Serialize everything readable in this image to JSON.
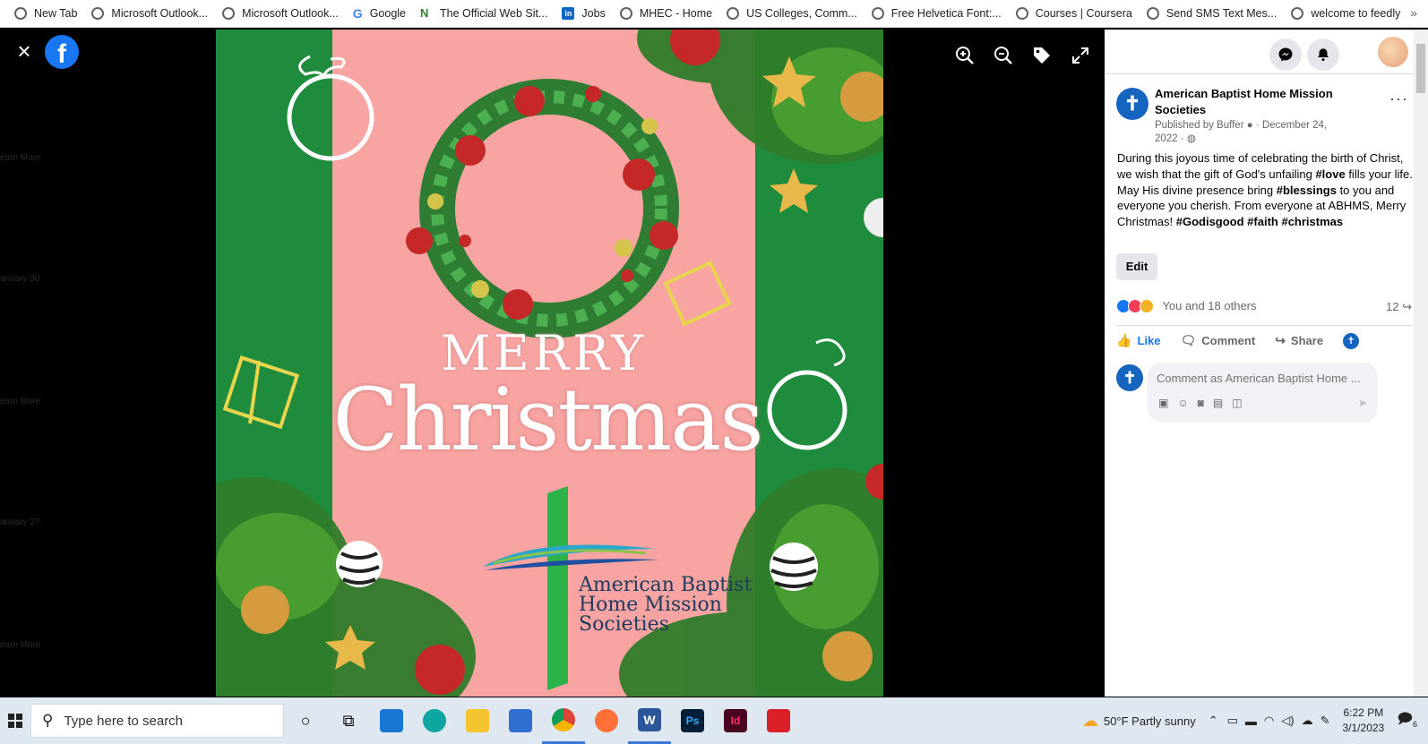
{
  "bookmarks": [
    {
      "label": "New Tab",
      "icon": "globe-icon"
    },
    {
      "label": "Microsoft Outlook...",
      "icon": "globe-icon"
    },
    {
      "label": "Microsoft Outlook...",
      "icon": "globe-icon"
    },
    {
      "label": "Google",
      "icon": "google-icon"
    },
    {
      "label": "The Official Web Sit...",
      "icon": "mhec-icon"
    },
    {
      "label": "Jobs",
      "icon": "linkedin-icon"
    },
    {
      "label": "MHEC - Home",
      "icon": "globe-icon"
    },
    {
      "label": "US Colleges, Comm...",
      "icon": "globe-icon"
    },
    {
      "label": "Free Helvetica Font:...",
      "icon": "globe-icon"
    },
    {
      "label": "Courses | Coursera",
      "icon": "globe-icon"
    },
    {
      "label": "Send SMS Text Mes...",
      "icon": "globe-icon"
    },
    {
      "label": "welcome to feedly",
      "icon": "globe-icon"
    }
  ],
  "bookmarks_more": "»",
  "viewer": {
    "close": "×",
    "fb_logo": "f",
    "ghost_labels": [
      "earn More",
      "anuary 30",
      "earn More",
      "anuary 27",
      "earn More"
    ]
  },
  "poster": {
    "merry": "MERRY",
    "christmas": "Christmas",
    "org_line1": "American Baptist",
    "org_line2": "Home Mission",
    "org_line3": "Societies"
  },
  "panel": {
    "org_name": "American Baptist Home Mission Societies",
    "published": "Published by Buffer",
    "date": "December 24, 2022",
    "more": "···",
    "text_1": "During this joyous time of celebrating the birth of Christ, we wish that the gift of God's unfailing ",
    "tag_love": "#love",
    "text_2": " fills your life. May His divine presence bring ",
    "tag_blessings": "#blessings",
    "text_3": " to you and everyone you cherish. From everyone at ABHMS, Merry Christmas! ",
    "tags_end": "#Godisgood #faith #christmas",
    "edit": "Edit",
    "reactions_text": "You and 18 others",
    "share_count": "12",
    "like": "Like",
    "comment": "Comment",
    "share": "Share",
    "comment_placeholder": "Comment as American Baptist Home ..."
  },
  "taskbar": {
    "search_placeholder": "Type here to search",
    "weather": "50°F  Partly sunny",
    "time": "6:22 PM",
    "date": "3/1/2023",
    "notif_count": "6"
  },
  "colors": {
    "facebook_blue": "#1877f2",
    "poster_pink": "#f7a4a2",
    "poster_green": "#1e8b3d"
  }
}
